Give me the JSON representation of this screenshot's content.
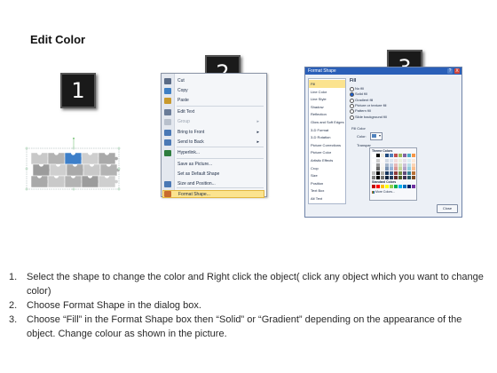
{
  "title": "Edit Color",
  "badges": [
    "1",
    "2",
    "3"
  ],
  "context_menu": {
    "items": [
      {
        "label": "Cut",
        "icon": "scissors-icon",
        "color": "#5a6b86"
      },
      {
        "label": "Copy",
        "icon": "copy-icon",
        "color": "#3f7fc4"
      },
      {
        "label": "Paste",
        "icon": "paste-icon",
        "color": "#c99a2e"
      },
      {
        "label": "Edit Text",
        "icon": "text-box-icon",
        "color": "#6a7c98"
      },
      {
        "label": "Group",
        "icon": "group-icon",
        "color": "#b8c0cc",
        "disabled": true,
        "submenu": true
      },
      {
        "label": "Bring to Front",
        "icon": "bring-front-icon",
        "color": "#4a78b5",
        "submenu": true
      },
      {
        "label": "Send to Back",
        "icon": "send-back-icon",
        "color": "#4a78b5",
        "submenu": true
      },
      {
        "label": "Hyperlink...",
        "icon": "hyperlink-icon",
        "color": "#2e7d3e"
      },
      {
        "label": "Save as Picture...",
        "icon": "",
        "color": ""
      },
      {
        "label": "Set as Default Shape",
        "icon": "",
        "color": ""
      },
      {
        "label": "Size and Position...",
        "icon": "size-position-icon",
        "color": "#4a78b5"
      },
      {
        "label": "Format Shape...",
        "icon": "format-shape-icon",
        "color": "#c76b2e",
        "selected": true
      }
    ]
  },
  "dialog": {
    "title": "Format Shape",
    "help": "?",
    "close_x": "X",
    "categories": [
      "Fill",
      "Line Color",
      "Line Style",
      "Shadow",
      "Reflection",
      "Glow and Soft Edges",
      "3-D Format",
      "3-D Rotation",
      "Picture Corrections",
      "Picture Color",
      "Artistic Effects",
      "Crop",
      "Size",
      "Position",
      "Text Box",
      "Alt Text"
    ],
    "pane_heading": "Fill",
    "options": [
      {
        "label": "No fill",
        "on": false
      },
      {
        "label": "Solid fill",
        "on": true
      },
      {
        "label": "Gradient fill",
        "on": false
      },
      {
        "label": "Picture or texture fill",
        "on": false
      },
      {
        "label": "Pattern fill",
        "on": false
      },
      {
        "label": "Slide background fill",
        "on": false
      }
    ],
    "fill_color_heading": "Fill Color",
    "color_label": "Color:",
    "transparency_label": "Transpar",
    "palette": {
      "theme_heading": "Theme Colors",
      "standard_heading": "Standard Colors",
      "more_colors": "More Colors...",
      "theme_top": [
        "#ffffff",
        "#000000",
        "#eeece1",
        "#1f497d",
        "#4f81bd",
        "#c0504d",
        "#9bbb59",
        "#8064a2",
        "#4bacc6",
        "#f79646"
      ],
      "standard": [
        "#c00000",
        "#ff0000",
        "#ffc000",
        "#ffff00",
        "#92d050",
        "#00b050",
        "#00b0f0",
        "#0070c0",
        "#002060",
        "#7030a0"
      ]
    },
    "close_button": "Close"
  },
  "steps": [
    {
      "n": "1.",
      "text": "Select the shape to change the color and Right click the object( click any object which you want to change color)"
    },
    {
      "n": "2.",
      "text": "Choose Format Shape in the dialog box."
    },
    {
      "n": "3.",
      "text": "Choose “Fill” in the Format Shape box then “Solid” or “Gradient” depending on the appearance of the object. Change colour as shown in the picture."
    }
  ],
  "colors": {
    "accent_piece": "#3d7fc9",
    "menu_highlight": "#fbe38f",
    "dialog_titlebar": "#2a5fb8"
  }
}
